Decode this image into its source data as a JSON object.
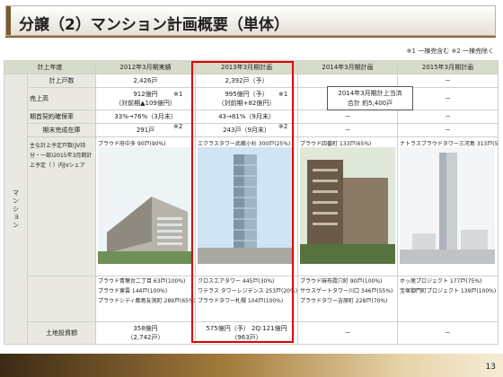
{
  "title": "分譲（2）マンション計画概要（単体）",
  "note": "※1 一棟売含む ※2 一棟売除く",
  "header": {
    "col0": "計上年度",
    "col1": "2012年3月期実績",
    "col2": "2013年3月期計画",
    "col3": "2014年3月期計画",
    "col4": "2015年3月期計画"
  },
  "rows": {
    "units": {
      "label": "計上戸数",
      "c1": "2,426戸",
      "c2": "2,392戸（予）",
      "c3": "",
      "c4": "－"
    },
    "sales": {
      "label": "売上高",
      "c1a": "912億円",
      "c1b": "（対前期▲109億円）",
      "c1star": "※1",
      "c2a": "995億円（予）",
      "c2b": "（対前期+82億円）",
      "c2star": "※1",
      "c3": "",
      "c4": "－"
    },
    "contract": {
      "label": "期首契約確保率",
      "c1": "33%→76%（3月末）",
      "c1star": "※2",
      "c2": "43→81%（9月末）",
      "c2star": "※2",
      "c3": "－",
      "c4": "－"
    },
    "inventory": {
      "label": "期末完成在庫",
      "c1": "291戸",
      "c2": "243戸（9月末）",
      "c3": "－",
      "c4": "－"
    },
    "land": {
      "label": "土地投資額",
      "c1a": "358億円",
      "c1b": "（2,742戸）",
      "c2a": "575億円（予） 2Q:121億円",
      "c2b": "（963戸）",
      "c3": "－",
      "c4": "－"
    }
  },
  "side_label": "マンション",
  "main_projects_label": "主な計上予定戸数(JV持分・一部)2015年3月期計上予定（ ）内JVシェア",
  "callout": {
    "line1": "2014年3月期計上当済",
    "line2": "合計 約5,400戸"
  },
  "projects": {
    "c1_top": "プラウド府中多 90戸(90%)",
    "c1_list": [
      "プラウド青葉台二丁目 63戸(100%)",
      "プラウド東雲 144戸(100%)",
      "プラウドシティ都島友渕町 289戸(65%)"
    ],
    "c2_top": "エクラスタワー武蔵小杉 300戸(25%)",
    "c2_list": [
      "クロスエアタワー 445戸(30%)",
      "ワテラス タワーレジデンス 253戸(20%)",
      "プラウドタワー札幌 104戸(100%)"
    ],
    "c3_top": "プラウド四番町 133戸(65%)",
    "c3_list": [
      "プラウド麻布霞穴町 90戸(100%)",
      "サウスゲートタワー川口 346戸(55%)",
      "プラウドタワー吉原町 228戸(70%)"
    ],
    "c4_top": "ナトラスプラウドタワー三河島 313戸(50%)",
    "c4_list": [
      "ホッ尾プロジェクト 177戸(75%)",
      "宝塚御門町プロジェクト 139戸(100%)"
    ]
  },
  "page_number": "13"
}
